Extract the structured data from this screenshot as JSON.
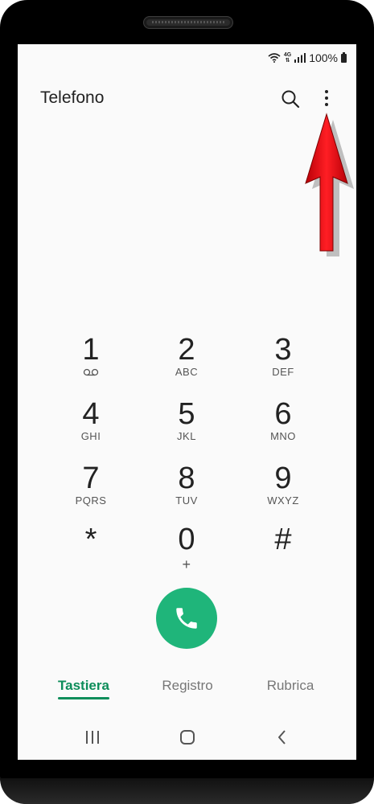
{
  "status_bar": {
    "network": "4G",
    "battery": "100%"
  },
  "header": {
    "title": "Telefono"
  },
  "keypad": [
    {
      "digit": "1",
      "letters": ""
    },
    {
      "digit": "2",
      "letters": "ABC"
    },
    {
      "digit": "3",
      "letters": "DEF"
    },
    {
      "digit": "4",
      "letters": "GHI"
    },
    {
      "digit": "5",
      "letters": "JKL"
    },
    {
      "digit": "6",
      "letters": "MNO"
    },
    {
      "digit": "7",
      "letters": "PQRS"
    },
    {
      "digit": "8",
      "letters": "TUV"
    },
    {
      "digit": "9",
      "letters": "WXYZ"
    },
    {
      "digit": "*",
      "letters": ""
    },
    {
      "digit": "0",
      "letters": "+"
    },
    {
      "digit": "#",
      "letters": ""
    }
  ],
  "tabs": [
    {
      "label": "Tastiera",
      "active": true
    },
    {
      "label": "Registro",
      "active": false
    },
    {
      "label": "Rubrica",
      "active": false
    }
  ],
  "colors": {
    "accent": "#1fb57a",
    "active_tab": "#0d8d5a",
    "annotation_arrow": "#e8141b"
  },
  "icons": {
    "search": "search-icon",
    "more": "more-vert-icon",
    "call": "phone-icon",
    "voicemail": "voicemail-icon",
    "nav_recents": "recents-icon",
    "nav_home": "home-icon",
    "nav_back": "back-icon"
  }
}
